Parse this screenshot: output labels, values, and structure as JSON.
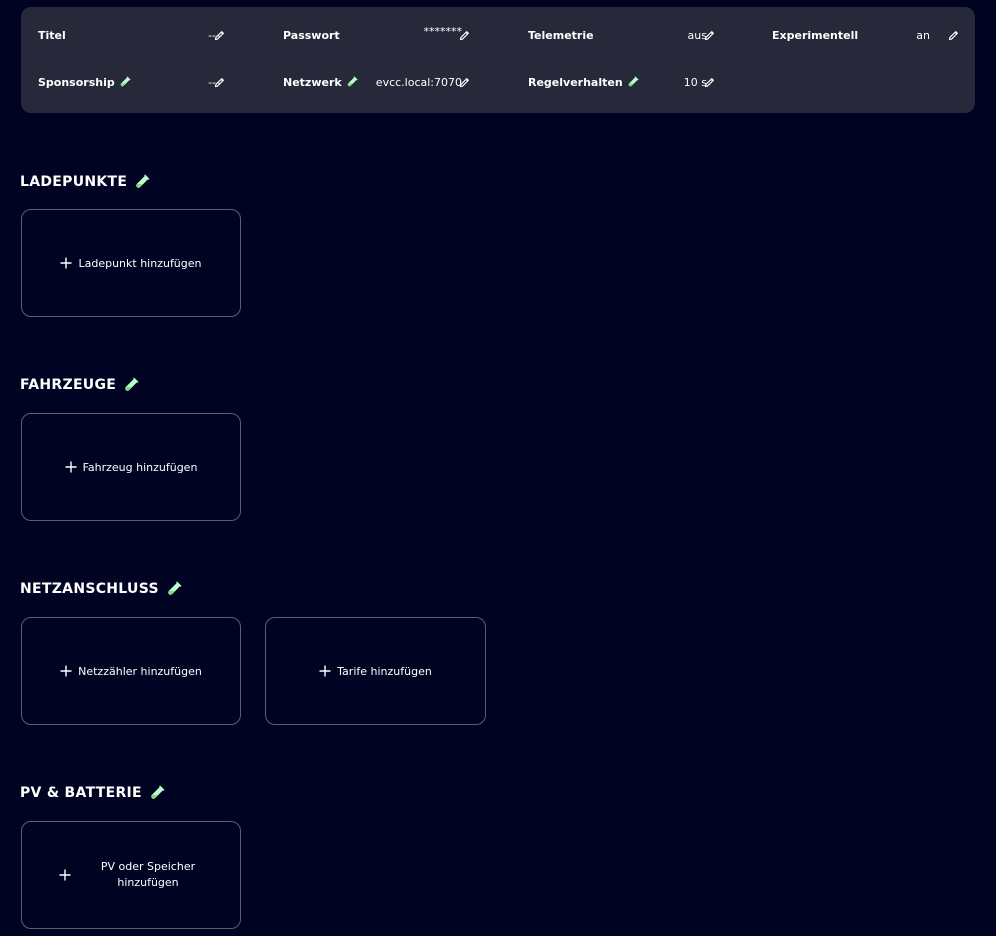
{
  "general": {
    "row1": [
      {
        "label": "Titel",
        "value": "---"
      },
      {
        "label": "Passwort",
        "value": "*******"
      },
      {
        "label": "Telemetrie",
        "value": "aus"
      },
      {
        "label": "Experimentell",
        "value": "an"
      }
    ],
    "row2": [
      {
        "label": "Sponsorship",
        "value": "---",
        "experimental": true
      },
      {
        "label": "Netzwerk",
        "value": "evcc.local:7070",
        "experimental": true
      },
      {
        "label": "Regelverhalten",
        "value": "10 s",
        "experimental": true
      }
    ]
  },
  "sections": {
    "loadpoints": {
      "title": "LADEPUNKTE",
      "add_label": "Ladepunkt hinzufügen"
    },
    "vehicles": {
      "title": "FAHRZEUGE",
      "add_label": "Fahrzeug hinzufügen"
    },
    "grid": {
      "title": "NETZANSCHLUSS",
      "add_meter_label": "Netzzähler hinzufügen",
      "add_tariff_label": "Tarife hinzufügen"
    },
    "pv_battery": {
      "title": "PV & BATTERIE",
      "add_label": "PV oder Speicher hinzufügen"
    }
  },
  "colors": {
    "background": "#010322",
    "panel": "#272839",
    "accent_experimental": "#baffcb",
    "card_border": "#5c5e72"
  },
  "icons": {
    "edit": "pencil-icon",
    "experimental": "flask-icon",
    "add": "plus-icon"
  }
}
